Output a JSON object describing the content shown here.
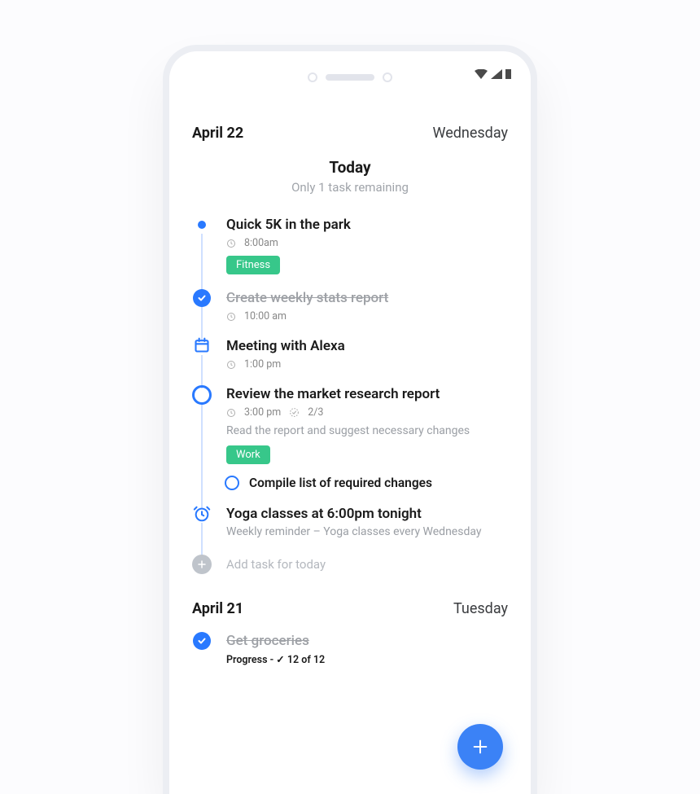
{
  "days": [
    {
      "date": "April 22",
      "dayname": "Wednesday",
      "summary_title": "Today",
      "summary_sub": "Only 1 task remaining"
    },
    {
      "date": "April 21",
      "dayname": "Tuesday"
    }
  ],
  "tasks": [
    {
      "title": "Quick 5K in the park",
      "time": "8:00am",
      "tag": "Fitness"
    },
    {
      "title": "Create weekly stats report",
      "time": "10:00 am"
    },
    {
      "title": "Meeting with Alexa",
      "time": "1:00 pm"
    },
    {
      "title": "Review the market research report",
      "time": "3:00 pm",
      "subcount": "2/3",
      "note": "Read the report and suggest necessary changes",
      "tag": "Work",
      "subtask": "Compile list of required changes"
    },
    {
      "title": "Yoga classes at 6:00pm tonight",
      "note": "Weekly reminder – Yoga classes every Wednesday"
    }
  ],
  "add_label": "Add task for today",
  "prev_tasks": [
    {
      "title": "Get groceries",
      "progress_prefix": "Progress - ",
      "progress_count": "12 of 12"
    }
  ]
}
